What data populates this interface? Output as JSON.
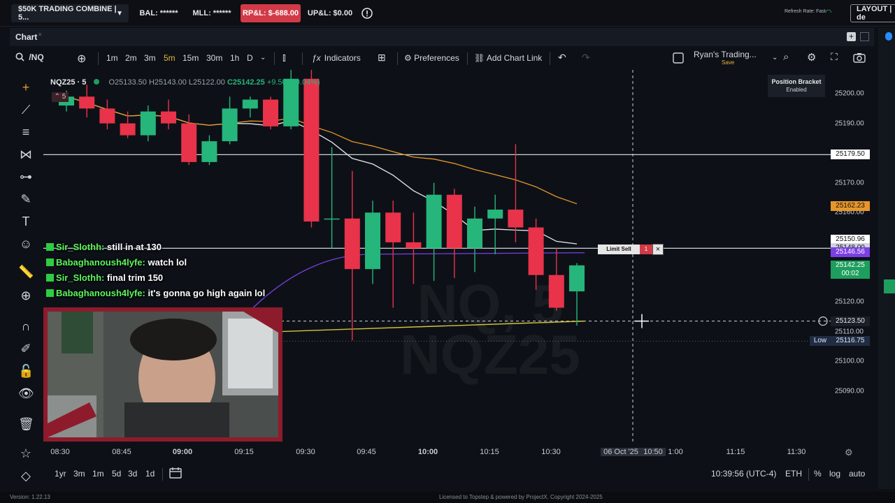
{
  "topbar": {
    "account": "$50K TRADING COMBINE | 5...",
    "balance": "BAL: ******",
    "mll": "MLL: ******",
    "rpl": "RP&L: $-688.00",
    "upl": "UP&L: $0.00",
    "refresh_rate": "Refresh Rate: Fast",
    "layout": "LAYOUT | de"
  },
  "tab": {
    "label": "Chart",
    "close": "×",
    "plus": "+"
  },
  "toolbar": {
    "symbol": "/NQ",
    "intervals": [
      "1m",
      "2m",
      "3m",
      "5m",
      "15m",
      "30m",
      "1h",
      "D"
    ],
    "active_interval": "5m",
    "indicators": "Indicators",
    "preferences": "Preferences",
    "add_chart_link": "Add Chart Link",
    "layout_name": "Ryan's Trading...",
    "layout_save": "Save"
  },
  "legend": {
    "symbol": "NQZ25 · 5",
    "o": "O25133.50",
    "h": "H25143.00",
    "l": "L25122.00",
    "c": "C25142.25",
    "change": "+9.50 (+0.04%)",
    "flag": "5"
  },
  "watermark": {
    "line1": "NQ, 5",
    "line2": "NQZ25"
  },
  "position_bracket": {
    "title": "Position Bracket",
    "status": "Enabled"
  },
  "limit_order": {
    "label": "Limit Sell",
    "qty": "1",
    "close": "×"
  },
  "chat": [
    {
      "user": "Sir_Slothh:",
      "msg": "still in at 130"
    },
    {
      "user": "Babaghanoush4lyfe:",
      "msg": "watch lol"
    },
    {
      "user": "Sir_Slothh:",
      "msg": "final trim 150"
    },
    {
      "user": "Babaghanoush4lyfe:",
      "msg": "it's gonna go high again lol"
    }
  ],
  "chart_data": {
    "type": "candlestick",
    "symbol": "NQZ25",
    "interval": "5",
    "y_range": [
      25083,
      25208
    ],
    "y_ticks": [
      25200,
      25190,
      25170,
      25160,
      25150,
      25130,
      25120,
      25110,
      25100,
      25090
    ],
    "x_ticks": [
      "08:30",
      "08:45",
      "09:00",
      "09:15",
      "09:30",
      "09:45",
      "10:00",
      "10:15",
      "10:30",
      "06 Oct '25",
      "10:50",
      "1:00",
      "11:15",
      "11:30"
    ],
    "price_tags": [
      {
        "label": "25179.50",
        "value": 25179.5,
        "bg": "#ffffff",
        "fg": "#111111"
      },
      {
        "label": "25162.23",
        "value": 25162.23,
        "bg": "#e8962a",
        "fg": "#111111"
      },
      {
        "label": "25150.96",
        "value": 25150.96,
        "bg": "#ffffff",
        "fg": "#111111"
      },
      {
        "label": "25148.00",
        "value": 25148.0,
        "bg": "#cfd3da",
        "fg": "#111111"
      },
      {
        "label": "25146.56",
        "value": 25146.56,
        "bg": "#7b3fe4",
        "fg": "#ffffff"
      },
      {
        "label": "25123.50",
        "value": 25123.5,
        "bg": "#1b1f27",
        "fg": "#e6e8eb"
      }
    ],
    "last_price": {
      "label": "25142.25",
      "timer": "00:02",
      "value": 25142.25,
      "bg": "#1e9e5e"
    },
    "low": {
      "label": "Low",
      "value_label": "25116.75",
      "value": 25116.75
    },
    "candles": [
      {
        "o": 25196,
        "h": 25201,
        "l": 25194,
        "c": 25199
      },
      {
        "o": 25199,
        "h": 25203,
        "l": 25192,
        "c": 25195
      },
      {
        "o": 25195,
        "h": 25198,
        "l": 25188,
        "c": 25190
      },
      {
        "o": 25190,
        "h": 25194,
        "l": 25185,
        "c": 25186
      },
      {
        "o": 25186,
        "h": 25196,
        "l": 25184,
        "c": 25194
      },
      {
        "o": 25194,
        "h": 25198,
        "l": 25188,
        "c": 25190
      },
      {
        "o": 25190,
        "h": 25193,
        "l": 25176,
        "c": 25177
      },
      {
        "o": 25177,
        "h": 25186,
        "l": 25176,
        "c": 25184
      },
      {
        "o": 25184,
        "h": 25199,
        "l": 25183,
        "c": 25195
      },
      {
        "o": 25195,
        "h": 25199,
        "l": 25192,
        "c": 25198
      },
      {
        "o": 25198,
        "h": 25199,
        "l": 25188,
        "c": 25189
      },
      {
        "o": 25189,
        "h": 25208,
        "l": 25188,
        "c": 25205
      },
      {
        "o": 25205,
        "h": 25208,
        "l": 25155,
        "c": 25157
      },
      {
        "o": 25158,
        "h": 25182,
        "l": 25148,
        "c": 25158
      },
      {
        "o": 25158,
        "h": 25174,
        "l": 25117,
        "c": 25141
      },
      {
        "o": 25141,
        "h": 25164,
        "l": 25136,
        "c": 25160
      },
      {
        "o": 25160,
        "h": 25164,
        "l": 25128,
        "c": 25150
      },
      {
        "o": 25150,
        "h": 25160,
        "l": 25136,
        "c": 25148
      },
      {
        "o": 25148,
        "h": 25170,
        "l": 25137,
        "c": 25166
      },
      {
        "o": 25166,
        "h": 25168,
        "l": 25138,
        "c": 25148
      },
      {
        "o": 25148,
        "h": 25162,
        "l": 25140,
        "c": 25158
      },
      {
        "o": 25158,
        "h": 25166,
        "l": 25146,
        "c": 25161
      },
      {
        "o": 25161,
        "h": 25183,
        "l": 25150,
        "c": 25155
      },
      {
        "o": 25155,
        "h": 25158,
        "l": 25134,
        "c": 25139
      },
      {
        "o": 25139,
        "h": 25148,
        "l": 25127,
        "c": 25128
      },
      {
        "o": 25133.5,
        "h": 25143,
        "l": 25122,
        "c": 25142.25
      }
    ]
  },
  "axis_labels": {
    "y": [
      "25200.00",
      "25190.00",
      "25170.00",
      "25160.00",
      "25130.00",
      "25120.00",
      "25110.00",
      "25100.00",
      "25090.00"
    ]
  },
  "bottom": {
    "ranges": [
      "1yr",
      "3m",
      "1m",
      "5d",
      "3d",
      "1d"
    ],
    "clock": "10:39:56 (UTC-4)",
    "session": "ETH",
    "percent": "%",
    "log": "log",
    "auto": "auto"
  },
  "footer": {
    "version": "Version: 1.22.13",
    "license": "Licensed to Topstep & powered by ProjectX. Copyright 2024-2025"
  }
}
